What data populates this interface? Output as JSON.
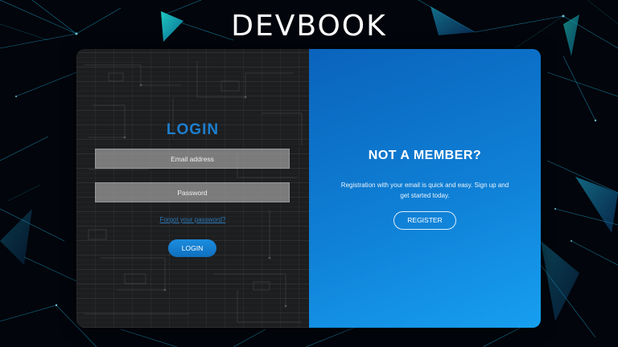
{
  "brand": {
    "logo_text": "DEVBOOK"
  },
  "login": {
    "title": "LOGIN",
    "email_placeholder": "Email address",
    "password_placeholder": "Password",
    "forgot_link": "Forgot your password?",
    "button_label": "LOGIN"
  },
  "register": {
    "title": "NOT A MEMBER?",
    "description": "Registration with your email is quick and easy. Sign up and get started today.",
    "button_label": "REGISTER"
  },
  "colors": {
    "accent_blue": "#1d7fcf",
    "register_panel_top": "#0a63bc",
    "register_panel_bottom": "#179ff0",
    "login_panel": "#1d1e20",
    "background": "#02050b",
    "network_lines": "#1aa7c9"
  }
}
